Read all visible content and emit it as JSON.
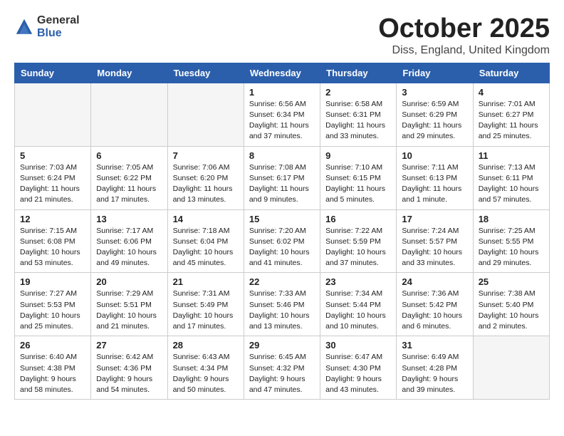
{
  "logo": {
    "general": "General",
    "blue": "Blue"
  },
  "header": {
    "month": "October 2025",
    "location": "Diss, England, United Kingdom"
  },
  "weekdays": [
    "Sunday",
    "Monday",
    "Tuesday",
    "Wednesday",
    "Thursday",
    "Friday",
    "Saturday"
  ],
  "weeks": [
    [
      {
        "day": "",
        "info": ""
      },
      {
        "day": "",
        "info": ""
      },
      {
        "day": "",
        "info": ""
      },
      {
        "day": "1",
        "info": "Sunrise: 6:56 AM\nSunset: 6:34 PM\nDaylight: 11 hours and 37 minutes."
      },
      {
        "day": "2",
        "info": "Sunrise: 6:58 AM\nSunset: 6:31 PM\nDaylight: 11 hours and 33 minutes."
      },
      {
        "day": "3",
        "info": "Sunrise: 6:59 AM\nSunset: 6:29 PM\nDaylight: 11 hours and 29 minutes."
      },
      {
        "day": "4",
        "info": "Sunrise: 7:01 AM\nSunset: 6:27 PM\nDaylight: 11 hours and 25 minutes."
      }
    ],
    [
      {
        "day": "5",
        "info": "Sunrise: 7:03 AM\nSunset: 6:24 PM\nDaylight: 11 hours and 21 minutes."
      },
      {
        "day": "6",
        "info": "Sunrise: 7:05 AM\nSunset: 6:22 PM\nDaylight: 11 hours and 17 minutes."
      },
      {
        "day": "7",
        "info": "Sunrise: 7:06 AM\nSunset: 6:20 PM\nDaylight: 11 hours and 13 minutes."
      },
      {
        "day": "8",
        "info": "Sunrise: 7:08 AM\nSunset: 6:17 PM\nDaylight: 11 hours and 9 minutes."
      },
      {
        "day": "9",
        "info": "Sunrise: 7:10 AM\nSunset: 6:15 PM\nDaylight: 11 hours and 5 minutes."
      },
      {
        "day": "10",
        "info": "Sunrise: 7:11 AM\nSunset: 6:13 PM\nDaylight: 11 hours and 1 minute."
      },
      {
        "day": "11",
        "info": "Sunrise: 7:13 AM\nSunset: 6:11 PM\nDaylight: 10 hours and 57 minutes."
      }
    ],
    [
      {
        "day": "12",
        "info": "Sunrise: 7:15 AM\nSunset: 6:08 PM\nDaylight: 10 hours and 53 minutes."
      },
      {
        "day": "13",
        "info": "Sunrise: 7:17 AM\nSunset: 6:06 PM\nDaylight: 10 hours and 49 minutes."
      },
      {
        "day": "14",
        "info": "Sunrise: 7:18 AM\nSunset: 6:04 PM\nDaylight: 10 hours and 45 minutes."
      },
      {
        "day": "15",
        "info": "Sunrise: 7:20 AM\nSunset: 6:02 PM\nDaylight: 10 hours and 41 minutes."
      },
      {
        "day": "16",
        "info": "Sunrise: 7:22 AM\nSunset: 5:59 PM\nDaylight: 10 hours and 37 minutes."
      },
      {
        "day": "17",
        "info": "Sunrise: 7:24 AM\nSunset: 5:57 PM\nDaylight: 10 hours and 33 minutes."
      },
      {
        "day": "18",
        "info": "Sunrise: 7:25 AM\nSunset: 5:55 PM\nDaylight: 10 hours and 29 minutes."
      }
    ],
    [
      {
        "day": "19",
        "info": "Sunrise: 7:27 AM\nSunset: 5:53 PM\nDaylight: 10 hours and 25 minutes."
      },
      {
        "day": "20",
        "info": "Sunrise: 7:29 AM\nSunset: 5:51 PM\nDaylight: 10 hours and 21 minutes."
      },
      {
        "day": "21",
        "info": "Sunrise: 7:31 AM\nSunset: 5:49 PM\nDaylight: 10 hours and 17 minutes."
      },
      {
        "day": "22",
        "info": "Sunrise: 7:33 AM\nSunset: 5:46 PM\nDaylight: 10 hours and 13 minutes."
      },
      {
        "day": "23",
        "info": "Sunrise: 7:34 AM\nSunset: 5:44 PM\nDaylight: 10 hours and 10 minutes."
      },
      {
        "day": "24",
        "info": "Sunrise: 7:36 AM\nSunset: 5:42 PM\nDaylight: 10 hours and 6 minutes."
      },
      {
        "day": "25",
        "info": "Sunrise: 7:38 AM\nSunset: 5:40 PM\nDaylight: 10 hours and 2 minutes."
      }
    ],
    [
      {
        "day": "26",
        "info": "Sunrise: 6:40 AM\nSunset: 4:38 PM\nDaylight: 9 hours and 58 minutes."
      },
      {
        "day": "27",
        "info": "Sunrise: 6:42 AM\nSunset: 4:36 PM\nDaylight: 9 hours and 54 minutes."
      },
      {
        "day": "28",
        "info": "Sunrise: 6:43 AM\nSunset: 4:34 PM\nDaylight: 9 hours and 50 minutes."
      },
      {
        "day": "29",
        "info": "Sunrise: 6:45 AM\nSunset: 4:32 PM\nDaylight: 9 hours and 47 minutes."
      },
      {
        "day": "30",
        "info": "Sunrise: 6:47 AM\nSunset: 4:30 PM\nDaylight: 9 hours and 43 minutes."
      },
      {
        "day": "31",
        "info": "Sunrise: 6:49 AM\nSunset: 4:28 PM\nDaylight: 9 hours and 39 minutes."
      },
      {
        "day": "",
        "info": ""
      }
    ]
  ]
}
